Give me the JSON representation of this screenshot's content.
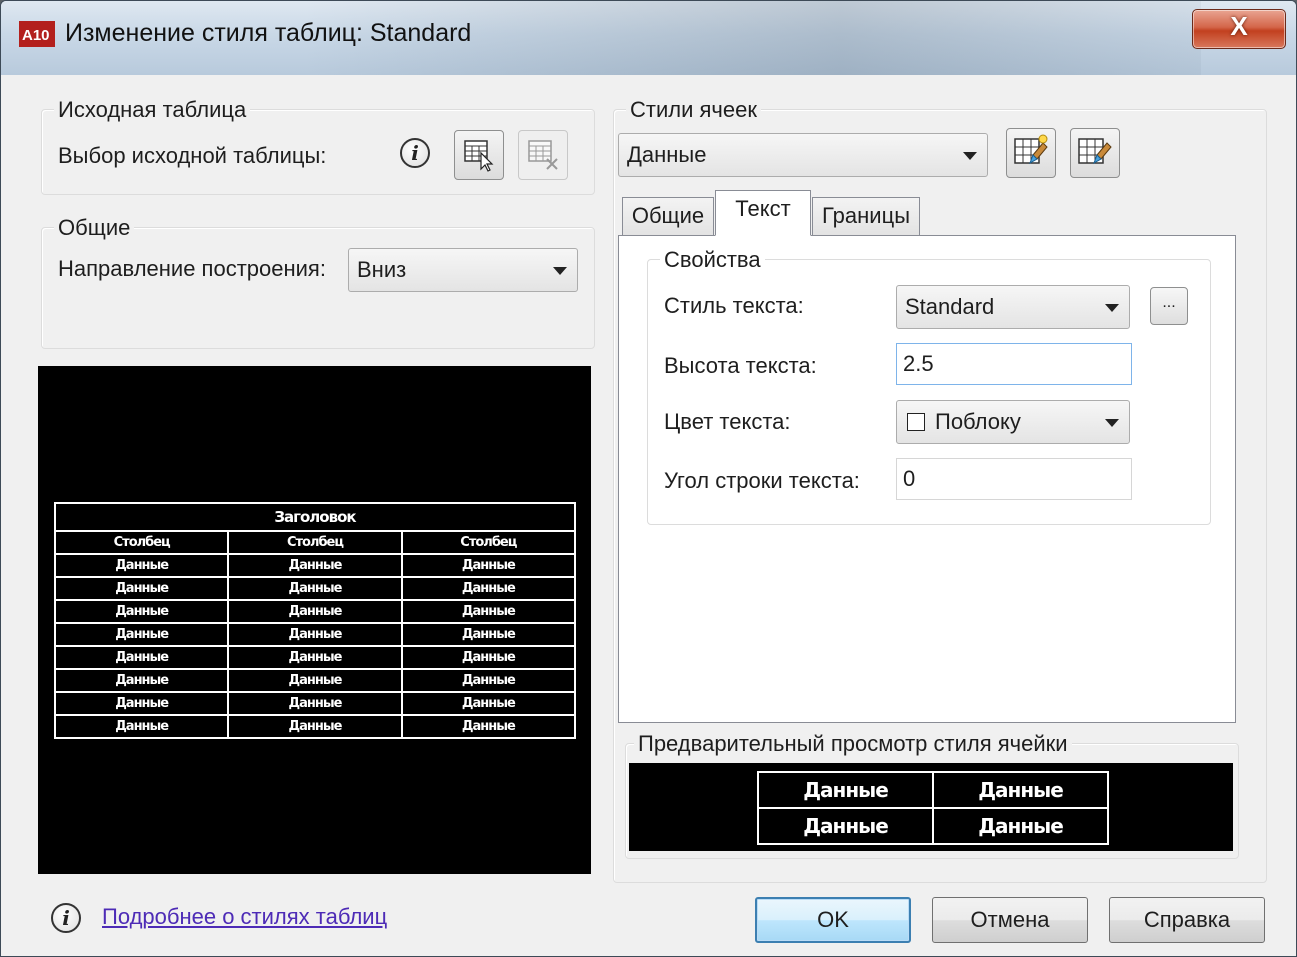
{
  "window": {
    "title": "Изменение стиля таблиц: Standard",
    "close_glyph": "X",
    "app_icon_text": "A10"
  },
  "starting_table": {
    "group_title": "Исходная таблица",
    "select_label": "Выбор исходной таблицы:"
  },
  "general": {
    "group_title": "Общие",
    "direction_label": "Направление построения:",
    "direction_value": "Вниз"
  },
  "table_preview": {
    "header": "Заголовок",
    "columns": [
      "Столбец",
      "Столбец",
      "Столбец"
    ],
    "rows": [
      [
        "Данные",
        "Данные",
        "Данные"
      ],
      [
        "Данные",
        "Данные",
        "Данные"
      ],
      [
        "Данные",
        "Данные",
        "Данные"
      ],
      [
        "Данные",
        "Данные",
        "Данные"
      ],
      [
        "Данные",
        "Данные",
        "Данные"
      ],
      [
        "Данные",
        "Данные",
        "Данные"
      ],
      [
        "Данные",
        "Данные",
        "Данные"
      ],
      [
        "Данные",
        "Данные",
        "Данные"
      ]
    ]
  },
  "cell_styles": {
    "group_title": "Стили ячеек",
    "selected_style": "Данные",
    "tabs": [
      "Общие",
      "Текст",
      "Границы"
    ],
    "active_tab": "Текст"
  },
  "properties": {
    "group_title": "Свойства",
    "text_style_label": "Стиль текста:",
    "text_style_value": "Standard",
    "ellipsis": "...",
    "text_height_label": "Высота текста:",
    "text_height_value": "2.5",
    "text_color_label": "Цвет текста:",
    "text_color_value": "Поблоку",
    "text_angle_label": "Угол строки текста:",
    "text_angle_value": "0"
  },
  "cell_preview": {
    "group_title": "Предварительный просмотр стиля ячейки",
    "cells": [
      [
        "Данные",
        "Данные"
      ],
      [
        "Данные",
        "Данные"
      ]
    ]
  },
  "footer": {
    "link": "Подробнее о стилях таблиц",
    "ok": "OK",
    "cancel": "Отмена",
    "help": "Справка"
  },
  "icons": {
    "info": "i"
  }
}
